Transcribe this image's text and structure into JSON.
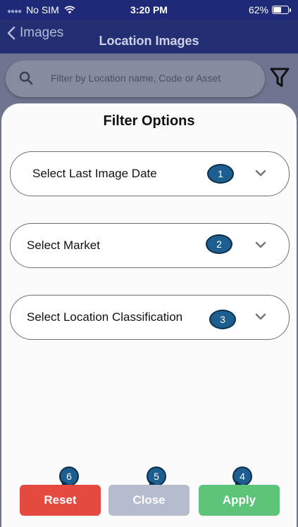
{
  "status_bar": {
    "carrier": "No SIM",
    "time": "3:20 PM",
    "battery": "62%",
    "battery_level": 0.62
  },
  "nav": {
    "back_label": "Images",
    "title": "Location Images"
  },
  "search": {
    "placeholder": "Filter by Location name, Code or Asset"
  },
  "sheet": {
    "title": "Filter Options",
    "selects": [
      {
        "label": "Select Last Image Date",
        "badge": "1"
      },
      {
        "label": "Select Market",
        "badge": "2"
      },
      {
        "label": "Select Location Classification",
        "badge": "3"
      }
    ]
  },
  "buttons": {
    "reset": {
      "label": "Reset",
      "badge": "6"
    },
    "close": {
      "label": "Close",
      "badge": "5"
    },
    "apply": {
      "label": "Apply",
      "badge": "4"
    }
  },
  "colors": {
    "nav_bg": "#1e2a78",
    "reset": "#e54a40",
    "close": "#b4bccd",
    "apply": "#5ec47a",
    "badge": "#1b5e8f"
  }
}
